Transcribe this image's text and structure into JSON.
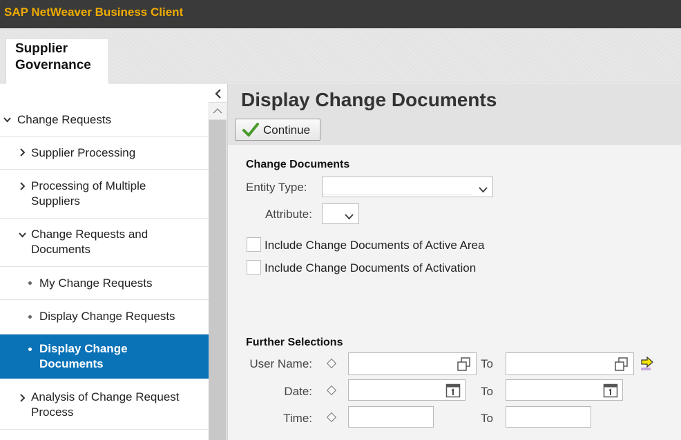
{
  "app": {
    "title": "SAP NetWeaver Business Client"
  },
  "tab": {
    "label": "Supplier\nGovernance"
  },
  "nav": {
    "items": [
      {
        "label": "Change Requests"
      },
      {
        "label": "Supplier Processing"
      },
      {
        "label": "Processing of Multiple\nSuppliers"
      },
      {
        "label": "Change Requests and\nDocuments"
      },
      {
        "label": "My Change Requests"
      },
      {
        "label": "Display Change Requests"
      },
      {
        "label": "Display Change\nDocuments"
      },
      {
        "label": "Analysis of Change Request\nProcess"
      }
    ],
    "selected": "Display Change Documents"
  },
  "page": {
    "title": "Display Change Documents",
    "continue_label": "Continue"
  },
  "change_documents": {
    "section_title": "Change Documents",
    "entity_type_label": "Entity Type:",
    "entity_type_value": "",
    "attribute_label": "Attribute:",
    "attribute_value": "",
    "checkbox_active_area": "Include Change Documents of Active Area",
    "checkbox_activation": "Include Change Documents of Activation"
  },
  "further_selections": {
    "section_title": "Further Selections",
    "user_name_label": "User Name:",
    "date_label": "Date:",
    "time_label": "Time:",
    "to_label": "To"
  },
  "colors": {
    "brand_title": "#f0ab00",
    "selected_nav": "#0a73b8",
    "checkmark": "#4a9a2e"
  }
}
